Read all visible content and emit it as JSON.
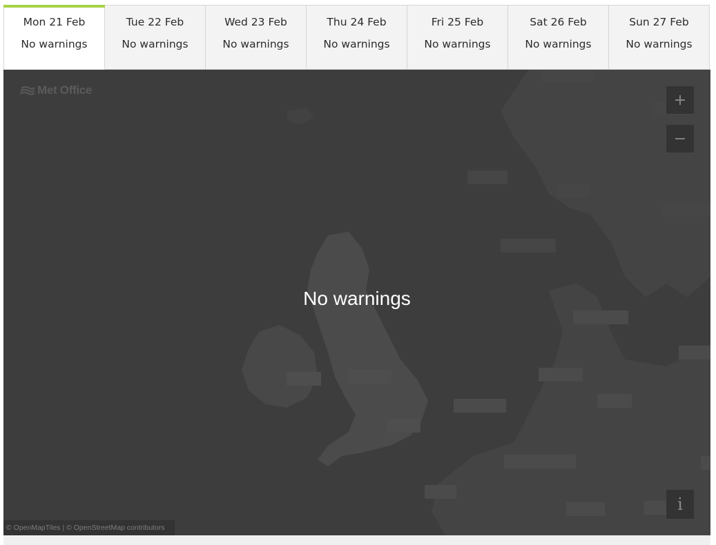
{
  "tabs": [
    {
      "date": "Mon 21 Feb",
      "status": "No warnings",
      "active": true
    },
    {
      "date": "Tue 22 Feb",
      "status": "No warnings",
      "active": false
    },
    {
      "date": "Wed 23 Feb",
      "status": "No warnings",
      "active": false
    },
    {
      "date": "Thu 24 Feb",
      "status": "No warnings",
      "active": false
    },
    {
      "date": "Fri 25 Feb",
      "status": "No warnings",
      "active": false
    },
    {
      "date": "Sat 26 Feb",
      "status": "No warnings",
      "active": false
    },
    {
      "date": "Sun 27 Feb",
      "status": "No warnings",
      "active": false
    }
  ],
  "map": {
    "logo_text": "Met Office",
    "message": "No warnings",
    "zoom_in_label": "+",
    "zoom_out_label": "−",
    "info_label": "i",
    "attribution": "© OpenMapTiles | © OpenStreetMap contributors"
  },
  "colors": {
    "active_tab_accent": "#a6d245",
    "map_background": "#3f3f3f",
    "control_background": "#333333"
  }
}
